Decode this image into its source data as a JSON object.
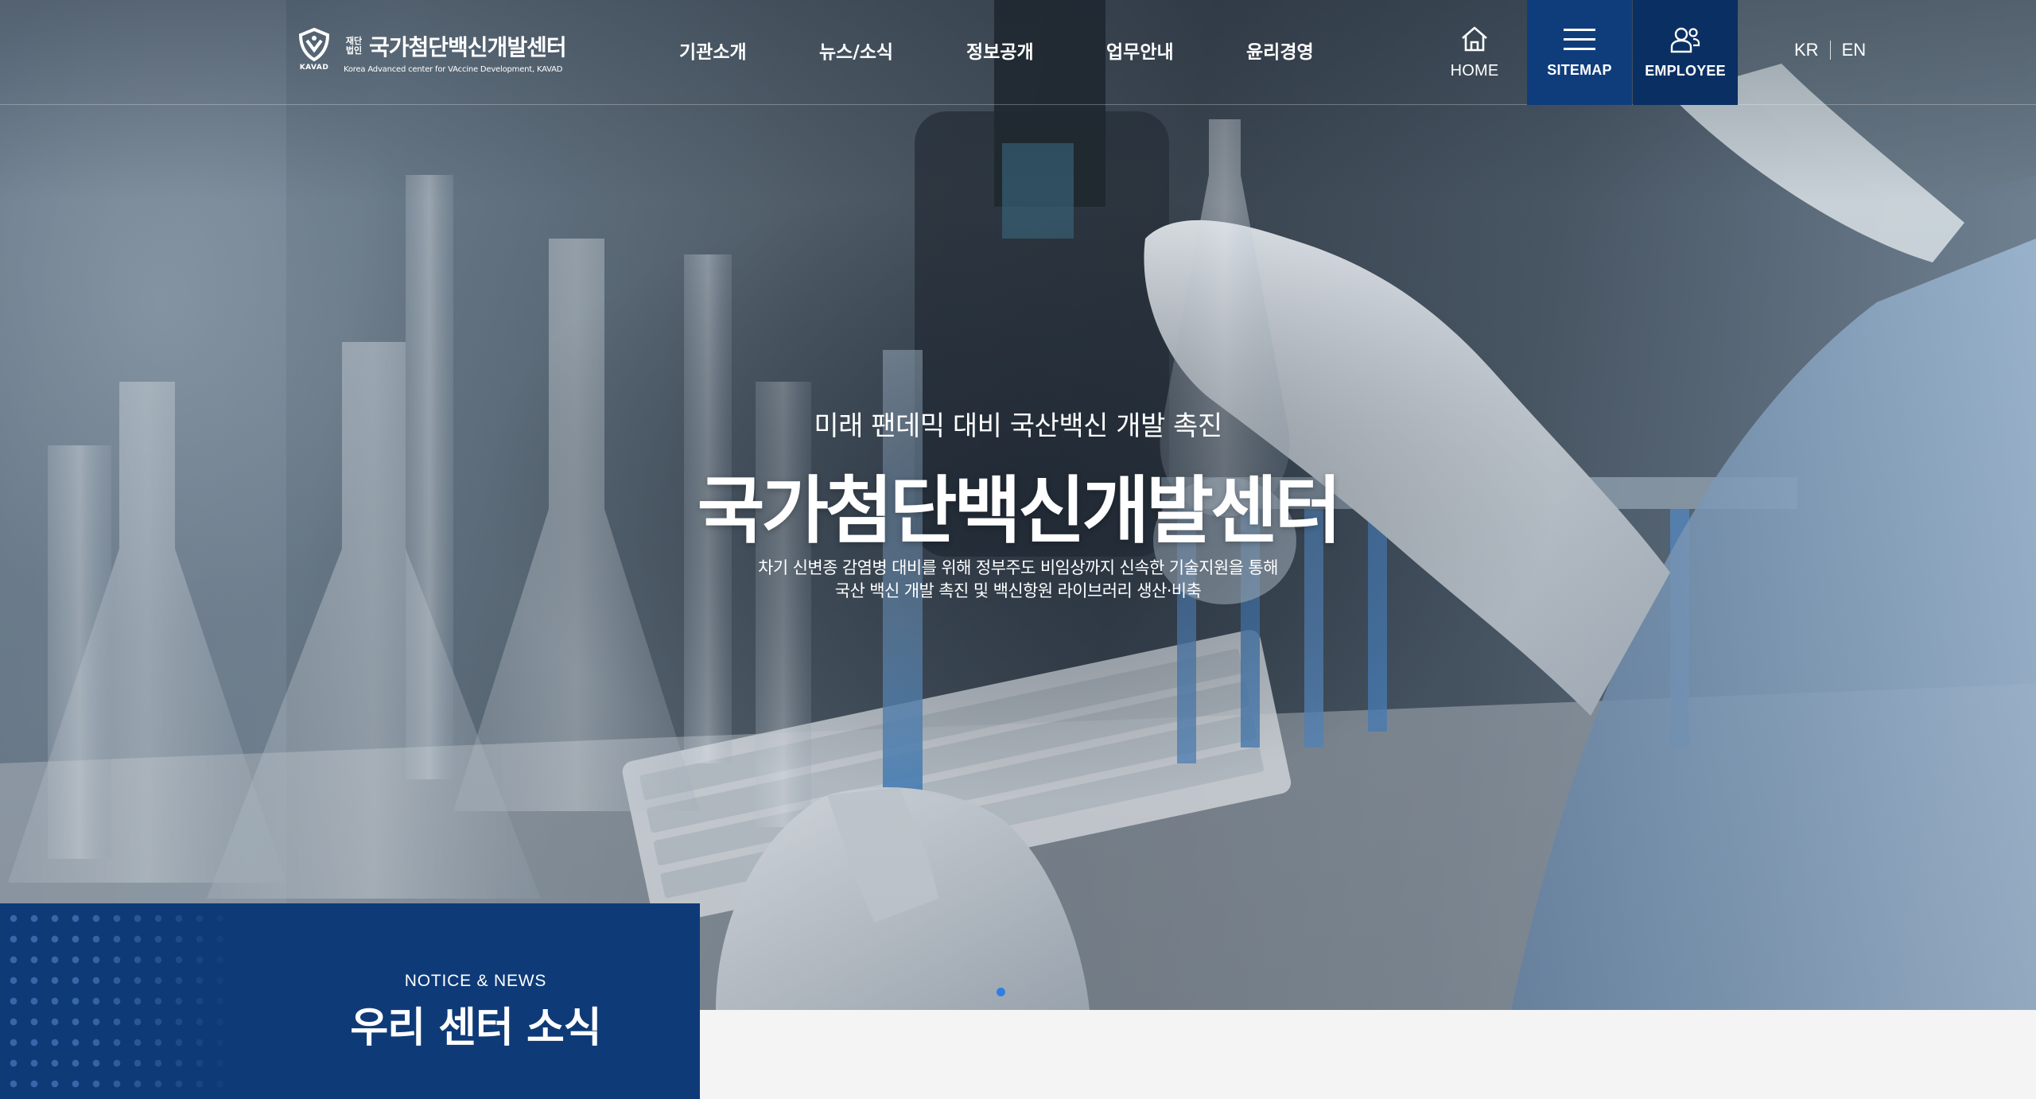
{
  "header": {
    "logo": {
      "emblem_text": "KAVAD",
      "prefix": "재단\n법인",
      "name": "국가첨단백신개발센터",
      "subtitle": "Korea Advanced center for VAccine Development, KAVAD"
    },
    "nav": [
      {
        "label": "기관소개"
      },
      {
        "label": "뉴스/소식"
      },
      {
        "label": "정보공개"
      },
      {
        "label": "업무안내"
      },
      {
        "label": "윤리경영"
      }
    ],
    "utility": {
      "home_label": "HOME",
      "sitemap_label": "SITEMAP",
      "employee_label": "EMPLOYEE"
    },
    "languages": [
      "KR",
      "EN"
    ]
  },
  "hero": {
    "kicker": "미래 팬데믹 대비 국산백신 개발 촉진",
    "title": "국가첨단백신개발센터",
    "description_line1": "차기 신변종 감염병 대비를 위해 정부주도 비임상까지 신속한 기술지원을 통해",
    "description_line2": "국산 백신 개발 촉진 및 백신항원 라이브러리 생산·비축",
    "slides_total": 1,
    "slide_active": 1
  },
  "notice": {
    "eyebrow": "NOTICE & NEWS",
    "title": "우리 센터 소식"
  },
  "colors": {
    "brand_navy": "#0e3b78",
    "sitemap_bg": "#0f3d7c",
    "employee_bg": "#0a2f63",
    "indicator": "#2f7fe0"
  }
}
